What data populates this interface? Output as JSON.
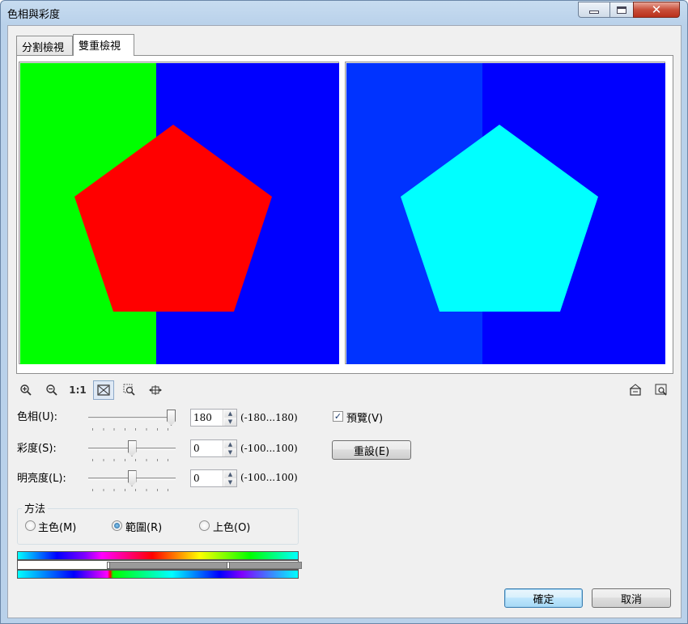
{
  "window": {
    "title": "色相與彩度",
    "close_glyph": "✕"
  },
  "tabs": [
    {
      "label": "分割檢視"
    },
    {
      "label": "雙重檢視"
    }
  ],
  "preview": {
    "original": {
      "left_color": "#00ff00",
      "right_color": "#0000ff",
      "shape_color": "#ff0000"
    },
    "result": {
      "left_color": "#0033ff",
      "right_color": "#0000ff",
      "shape_color": "#00ffff"
    }
  },
  "toolbar": {
    "zoom_in_icon": "zoom-in-icon",
    "zoom_out_icon": "zoom-out-icon",
    "actual_size_label": "1:1",
    "fit_icon": "fit-to-window-icon",
    "zoom_region_icon": "zoom-region-icon",
    "pan_icon": "pan-icon",
    "right_icons": [
      "preview-window-icon",
      "zoom-preview-icon"
    ]
  },
  "adjustments": {
    "hue": {
      "label": "色相(U):",
      "value": "180",
      "range": "(-180...180)",
      "level": 1.0
    },
    "saturation": {
      "label": "彩度(S):",
      "value": "0",
      "range": "(-100...100)",
      "level": 0.5
    },
    "lightness": {
      "label": "明亮度(L):",
      "value": "0",
      "range": "(-100...100)",
      "level": 0.5
    }
  },
  "preview_checkbox": {
    "label": "預覽(V)",
    "checked": true,
    "check_glyph": "✓"
  },
  "reset_button": {
    "label": "重設(E)"
  },
  "method": {
    "legend": "方法",
    "options": [
      {
        "label": "主色(M)",
        "selected": false
      },
      {
        "label": "範圍(R)",
        "selected": true
      },
      {
        "label": "上色(O)",
        "selected": false
      }
    ]
  },
  "buttons": {
    "ok": "確定",
    "cancel": "取消"
  }
}
